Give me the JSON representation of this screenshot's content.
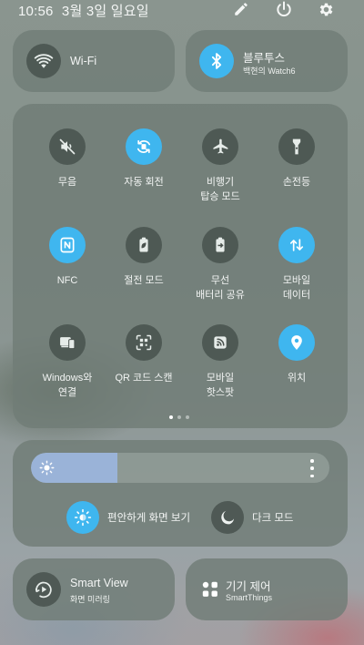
{
  "status_bar": {
    "time": "10:56",
    "date": "3월 3일 일요일",
    "icons": [
      "edit-icon",
      "power-icon",
      "settings-icon"
    ]
  },
  "top_tiles": {
    "wifi": {
      "label": "Wi-Fi",
      "icon": "wifi-icon",
      "state": "off"
    },
    "bluetooth": {
      "label": "블루투스",
      "sub": "백현의 Watch6",
      "icon": "bluetooth-icon",
      "state": "on"
    }
  },
  "quick_toggles": [
    {
      "label": "무음",
      "icon": "mute-icon",
      "state": "off"
    },
    {
      "label": "자동 회전",
      "icon": "auto-rotate-icon",
      "state": "on"
    },
    {
      "label": "비행기\n탑승 모드",
      "icon": "airplane-icon",
      "state": "off"
    },
    {
      "label": "손전등",
      "icon": "flashlight-icon",
      "state": "off"
    },
    {
      "label": "NFC",
      "icon": "nfc-icon",
      "state": "on"
    },
    {
      "label": "절전 모드",
      "icon": "battery-saver-icon",
      "state": "off"
    },
    {
      "label": "무선\n배터리 공유",
      "icon": "wireless-battery-share-icon",
      "state": "off"
    },
    {
      "label": "모바일\n데이터",
      "icon": "mobile-data-icon",
      "state": "on"
    },
    {
      "label": "Windows와\n연결",
      "icon": "link-to-windows-icon",
      "state": "off"
    },
    {
      "label": "QR 코드 스캔",
      "icon": "qr-scan-icon",
      "state": "off"
    },
    {
      "label": "모바일\n핫스팟",
      "icon": "hotspot-icon",
      "state": "off"
    },
    {
      "label": "위치",
      "icon": "location-icon",
      "state": "on"
    }
  ],
  "pager": {
    "current": 1,
    "total": 3
  },
  "brightness": {
    "level": 0.29,
    "icon": "brightness-icon",
    "more_icon": "more-vertical-icon"
  },
  "display_modes": {
    "eye_comfort": {
      "label": "편안하게 화면 보기",
      "icon": "eye-comfort-icon",
      "state": "on"
    },
    "dark_mode": {
      "label": "다크 모드",
      "icon": "moon-icon",
      "state": "off"
    }
  },
  "bottom_tiles": {
    "smart_view": {
      "title": "Smart View",
      "sub": "화면 미러링",
      "icon": "smart-view-icon"
    },
    "device_control": {
      "title": "기기 제어",
      "sub": "SmartThings",
      "icon": "device-control-icon"
    }
  },
  "colors": {
    "accent": "#3fb6ef",
    "toggle_off": "#4a524e",
    "brightness_fill": "#9ab3d8"
  }
}
